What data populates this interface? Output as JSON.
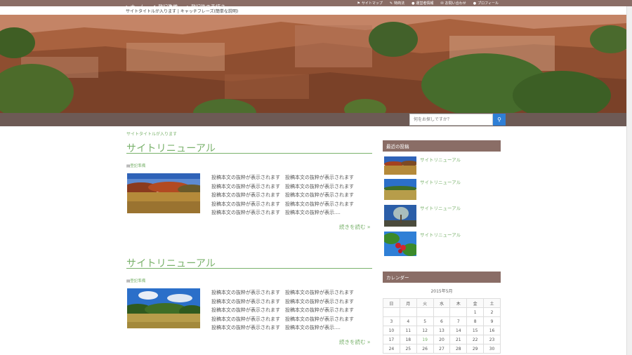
{
  "topbar": {
    "links": [
      {
        "icon": "sitemap-icon",
        "glyph": "⚑",
        "label": "サイトマップ"
      },
      {
        "icon": "wrench-icon",
        "glyph": "✎",
        "label": "特商法"
      },
      {
        "icon": "info-icon",
        "glyph": "●",
        "label": "運営者情報"
      },
      {
        "icon": "mail-icon",
        "glyph": "✉",
        "label": "お問い合わせ"
      },
      {
        "icon": "user-icon",
        "glyph": "●",
        "label": "プロフィール"
      }
    ]
  },
  "site": {
    "description": "サイトタイトルが入ります | キャッチフレーズ(簡単な説明)"
  },
  "nav": {
    "items": [
      {
        "icon": "home-icon",
        "glyph": "⌂",
        "label": "ホーム"
      },
      {
        "icon": "check-icon",
        "glyph": "✔",
        "label": "登記準備"
      },
      {
        "icon": "arrow-right-icon",
        "glyph": "➔",
        "label": "登記後の手続き"
      }
    ],
    "search_placeholder": "何をお探しですか？",
    "search_glyph": "⚲"
  },
  "breadcrumb": "サイトタイトルが入ります",
  "posts": [
    {
      "title": "サイトリニューアル",
      "category_prefix": "▤",
      "category": "登記準備",
      "excerpt": [
        "投稿本文の抜粋が表示されます　投稿本文の抜粋が表示されます",
        "投稿本文の抜粋が表示されます　投稿本文の抜粋が表示されます",
        "投稿本文の抜粋が表示されます　投稿本文の抜粋が表示されます",
        "投稿本文の抜粋が表示されます　投稿本文の抜粋が表示されます",
        "投稿本文の抜粋が表示されます　投稿本文の抜粋が表示...."
      ],
      "read_more": "続きを読む »"
    },
    {
      "title": "サイトリニューアル",
      "category_prefix": "▤",
      "category": "登記準備",
      "excerpt": [
        "投稿本文の抜粋が表示されます　投稿本文の抜粋が表示されます",
        "投稿本文の抜粋が表示されます　投稿本文の抜粋が表示されます",
        "投稿本文の抜粋が表示されます　投稿本文の抜粋が表示されます",
        "投稿本文の抜粋が表示されます　投稿本文の抜粋が表示されます",
        "投稿本文の抜粋が表示されます　投稿本文の抜粋が表示...."
      ],
      "read_more": "続きを読む »"
    }
  ],
  "sidebar": {
    "recent_heading": "最近の投稿",
    "recent": [
      {
        "title": "サイトリニューアル"
      },
      {
        "title": "サイトリニューアル"
      },
      {
        "title": "サイトリニューアル"
      },
      {
        "title": "サイトリニューアル"
      }
    ],
    "calendar_heading": "カレンダー",
    "calendar": {
      "caption": "2015年5月",
      "weekdays": [
        "日",
        "月",
        "火",
        "水",
        "木",
        "金",
        "土"
      ],
      "weeks": [
        [
          "",
          "",
          "",
          "",
          "",
          "1",
          "2"
        ],
        [
          "3",
          "4",
          "5",
          "6",
          "7",
          "8",
          "9"
        ],
        [
          "10",
          "11",
          "12",
          "13",
          "14",
          "15",
          "16"
        ],
        [
          "17",
          "18",
          "19",
          "20",
          "21",
          "22",
          "23"
        ],
        [
          "24",
          "25",
          "26",
          "27",
          "28",
          "29",
          "30"
        ]
      ],
      "highlight": "19"
    }
  },
  "colors": {
    "accent_green": "#7ab26c",
    "brown_bar": "#8a6d66",
    "nav_brown": "#6d5a55",
    "search_blue": "#2f7fd6"
  }
}
